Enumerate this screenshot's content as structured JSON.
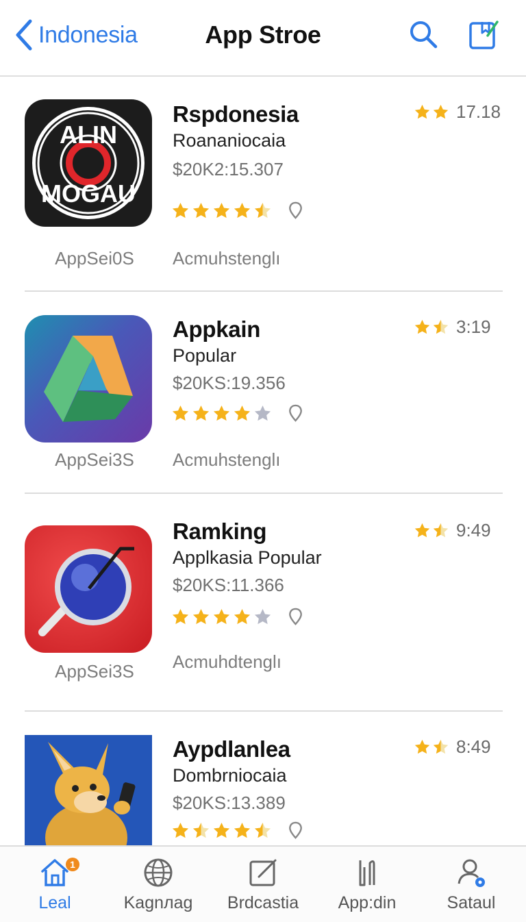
{
  "header": {
    "back_label": "Indonesia",
    "title": "App Stroe"
  },
  "apps": [
    {
      "name": "Rspdonesia",
      "subtitle": "Roananiocaia",
      "price": "$20K2:15.307",
      "stars": 5,
      "top_rating_text": "17.18",
      "caption_left": "AppSei0S",
      "caption_right": "Acmuhstenglı",
      "icon": "mogau-logo-icon"
    },
    {
      "name": "Appkain",
      "subtitle": "Popular",
      "price": "$20KS:19.356",
      "stars": 4,
      "top_rating_text": "3:19",
      "caption_left": "AppSei3S",
      "caption_right": "Acmuhstenglı",
      "icon": "colorful-triangle-icon"
    },
    {
      "name": "Ramking",
      "subtitle": "Applkasia Popular",
      "price": "$20KS:11.366",
      "stars": 4,
      "top_rating_text": "9:49",
      "caption_left": "AppSei3S",
      "caption_right": "Acmuhdtenglı",
      "icon": "magnifier-globe-icon"
    },
    {
      "name": "Aypdlanlea",
      "subtitle": "Dombrniocaia",
      "price": "$20KS:13.389",
      "stars": 4.5,
      "top_rating_text": "8:49",
      "icon": "kangaroo-phone-icon"
    }
  ],
  "tabs": [
    {
      "label": "Leal",
      "icon": "home-icon",
      "badge": "1",
      "active": true
    },
    {
      "label": "Kagnлag",
      "icon": "globe-icon"
    },
    {
      "label": "Brdcastia",
      "icon": "edit-icon"
    },
    {
      "label": "App:din",
      "icon": "tools-icon"
    },
    {
      "label": "Sataul",
      "icon": "account-icon"
    }
  ],
  "colors": {
    "accent": "#2f7be6",
    "star": "#f5b21a",
    "star_empty": "#b5b8c6"
  }
}
